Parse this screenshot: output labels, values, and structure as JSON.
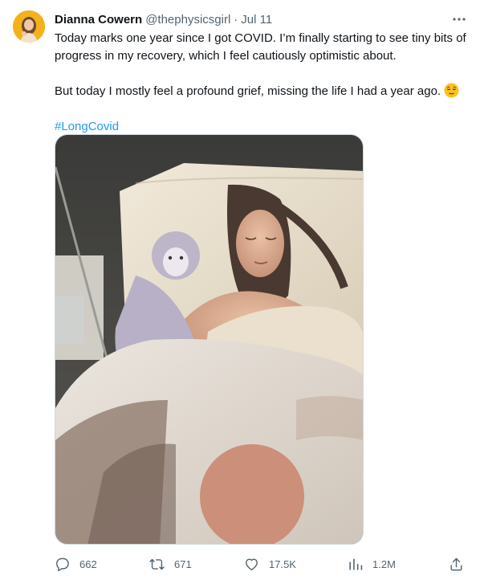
{
  "tweet": {
    "author_name": "Dianna Cowern",
    "handle": "@thephysicsgirl",
    "separator": "·",
    "date": "Jul 11",
    "paragraph_1": "Today marks one year since I got COVID. I’m finally starting to see tiny bits of progress in my recovery, which I feel cautiously optimistic about.",
    "paragraph_2": "But today I mostly feel a profound grief, missing the life I had a year ago.",
    "emoji": "relieved-face-emoji",
    "hashtag": "#LongCovid"
  },
  "metrics": {
    "replies": "662",
    "retweets": "671",
    "likes": "17.5K",
    "views": "1.2M"
  },
  "icons": {
    "more": "more-icon",
    "reply": "reply-icon",
    "retweet": "retweet-icon",
    "like": "heart-icon",
    "views": "views-icon",
    "share": "share-icon"
  },
  "colors": {
    "link": "#1d9bf0",
    "secondary_text": "#536471",
    "primary_text": "#0f1419"
  }
}
